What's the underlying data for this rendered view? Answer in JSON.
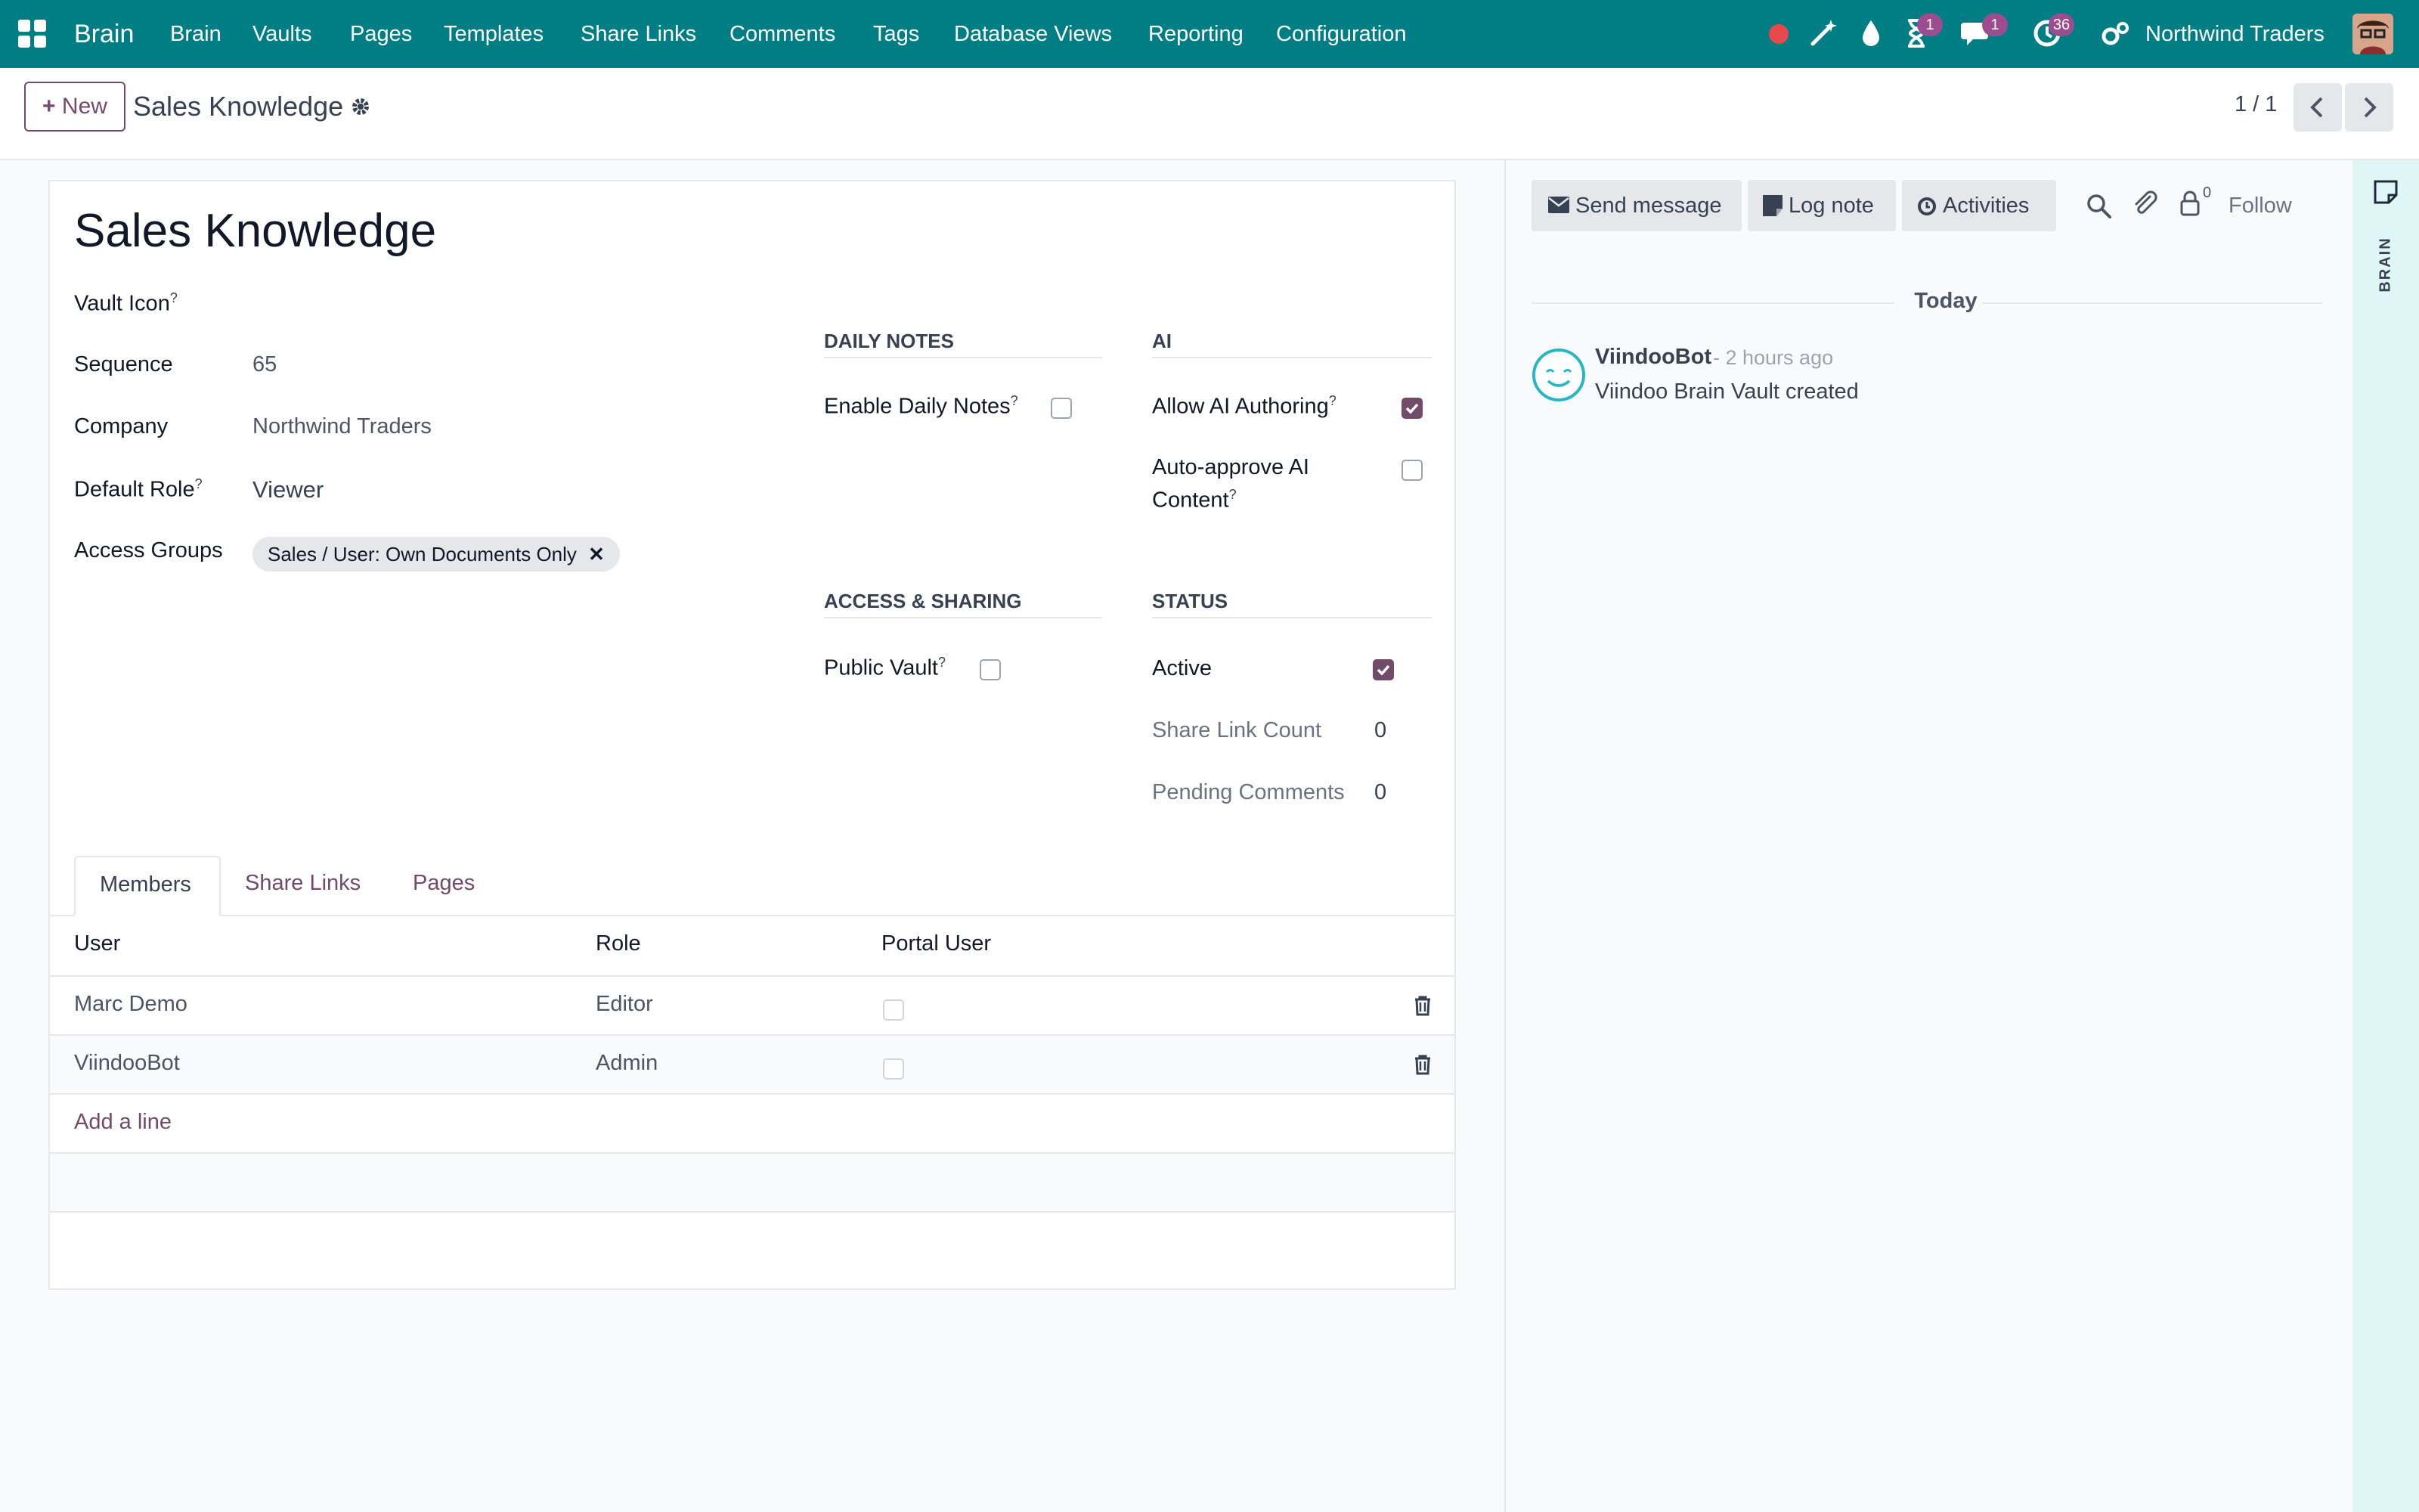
{
  "navbar": {
    "app_name": "Brain",
    "menus": [
      "Brain",
      "Vaults",
      "Pages",
      "Templates",
      "Share Links",
      "Comments",
      "Tags",
      "Database Views",
      "Reporting",
      "Configuration"
    ],
    "badges": {
      "activities": "1",
      "messages": "1",
      "clock": "36"
    },
    "company": "Northwind Traders",
    "colors": {
      "bar": "#017e84",
      "badge": "#9b4d8e",
      "record_dot": "#e5484d"
    }
  },
  "control": {
    "new_label": "New",
    "breadcrumb": "Sales Knowledge",
    "pager": "1 / 1"
  },
  "form": {
    "title": "Sales Knowledge",
    "fields": {
      "vault_icon_label": "Vault Icon",
      "sequence_label": "Sequence",
      "sequence_value": "65",
      "company_label": "Company",
      "company_value": "Northwind Traders",
      "default_role_label": "Default Role",
      "default_role_value": "Viewer",
      "access_groups_label": "Access Groups",
      "access_group_tag": "Sales / User: Own Documents Only"
    },
    "daily_notes": {
      "title": "DAILY NOTES",
      "enable_label": "Enable Daily Notes",
      "enable_checked": false
    },
    "ai": {
      "title": "AI",
      "allow_label": "Allow AI Authoring",
      "allow_checked": true,
      "auto_label_1": "Auto-approve AI",
      "auto_label_2": "Content",
      "auto_checked": false
    },
    "access_sharing": {
      "title": "ACCESS & SHARING",
      "public_label": "Public Vault",
      "public_checked": false
    },
    "status": {
      "title": "STATUS",
      "active_label": "Active",
      "active_checked": true,
      "share_count_label": "Share Link Count",
      "share_count_value": "0",
      "pending_label": "Pending Comments",
      "pending_value": "0"
    },
    "tooltip_mark": "?",
    "tabs": [
      "Members",
      "Share Links",
      "Pages"
    ],
    "members": {
      "columns": [
        "User",
        "Role",
        "Portal User"
      ],
      "rows": [
        {
          "user": "Marc Demo",
          "role": "Editor",
          "portal": false
        },
        {
          "user": "ViindooBot",
          "role": "Admin",
          "portal": false
        }
      ],
      "add_line": "Add a line"
    },
    "accent_color": "#714b67"
  },
  "chatter": {
    "send_message": "Send message",
    "log_note": "Log note",
    "activities": "Activities",
    "followers_count": "0",
    "follow": "Follow",
    "date_separator": "Today",
    "message": {
      "author": "ViindooBot",
      "time": "- 2 hours ago",
      "body": "Viindoo Brain Vault created"
    }
  },
  "side_panel": {
    "label": "BRAIN"
  }
}
